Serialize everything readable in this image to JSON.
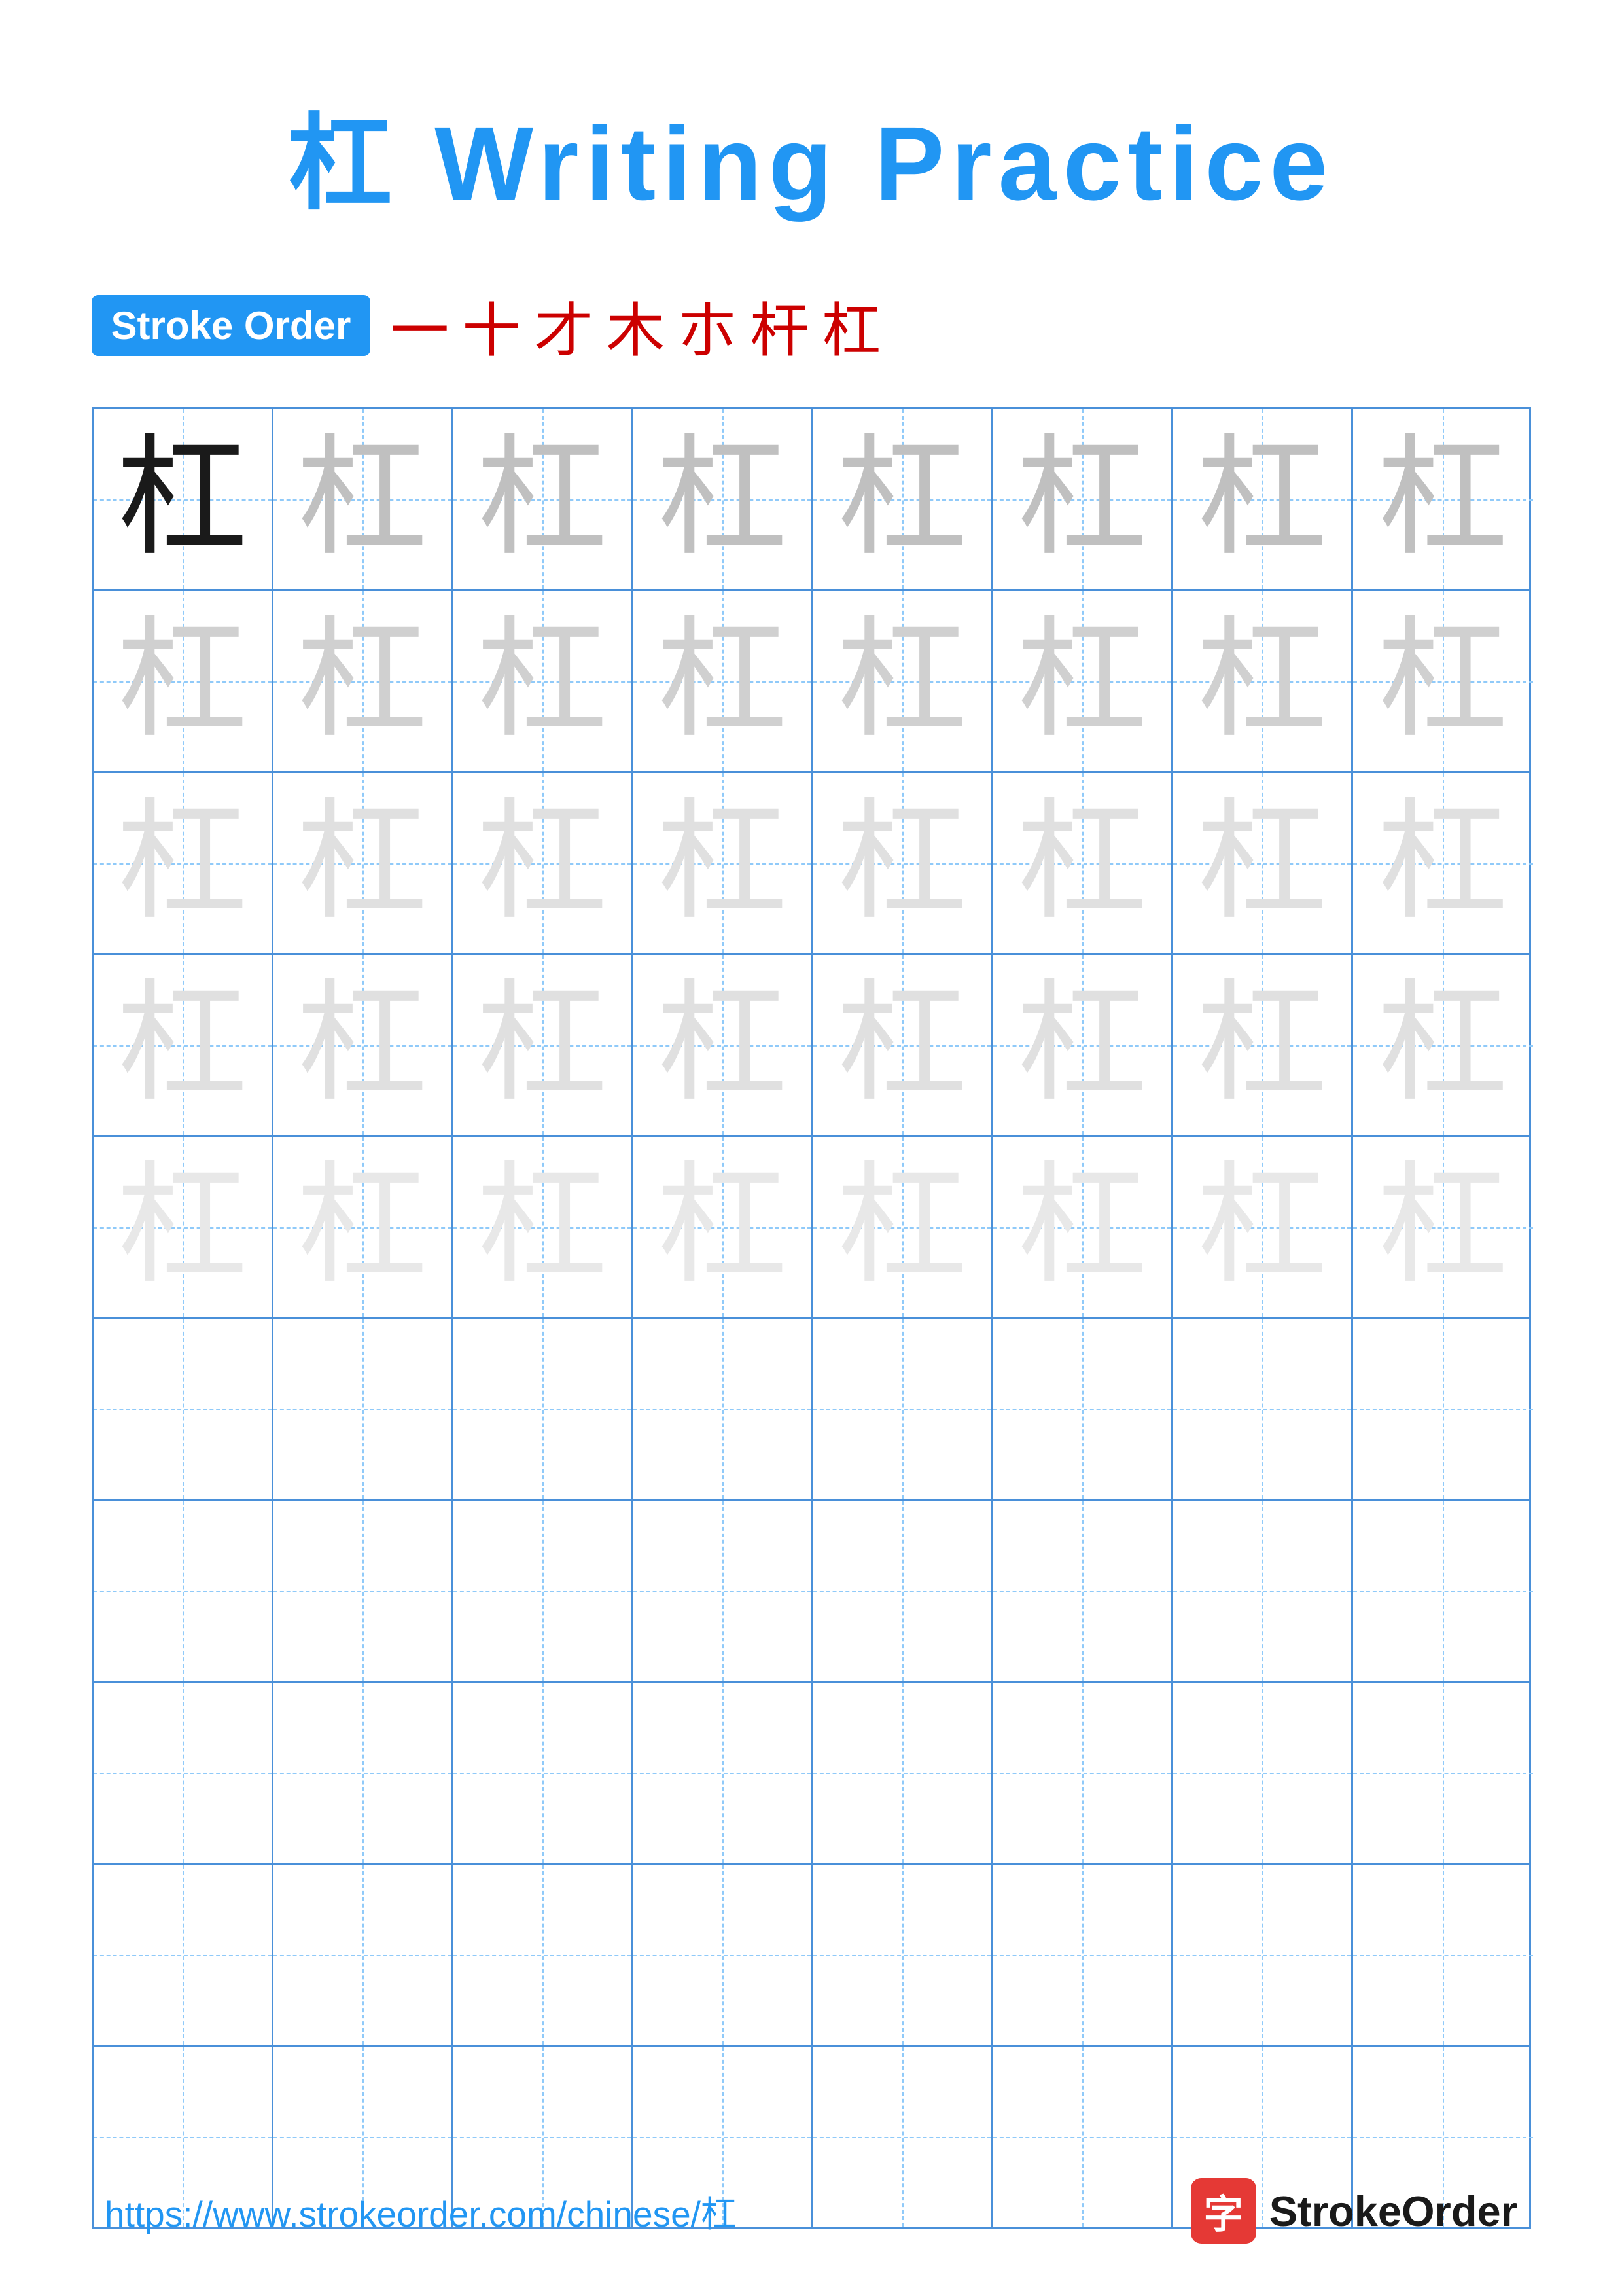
{
  "title": "杠 Writing Practice",
  "stroke_order": {
    "badge_label": "Stroke Order",
    "strokes": [
      "一",
      "十",
      "才",
      "木",
      "朩",
      "杆",
      "杠"
    ]
  },
  "grid": {
    "rows": 10,
    "cols": 8,
    "character": "杠",
    "filled_rows": 5,
    "empty_rows": 5,
    "char_opacities": [
      "dark",
      "light1",
      "light2",
      "light3",
      "light4"
    ]
  },
  "footer": {
    "url": "https://www.strokeorder.com/chinese/杠",
    "brand_icon": "字",
    "brand_name": "StrokeOrder"
  }
}
